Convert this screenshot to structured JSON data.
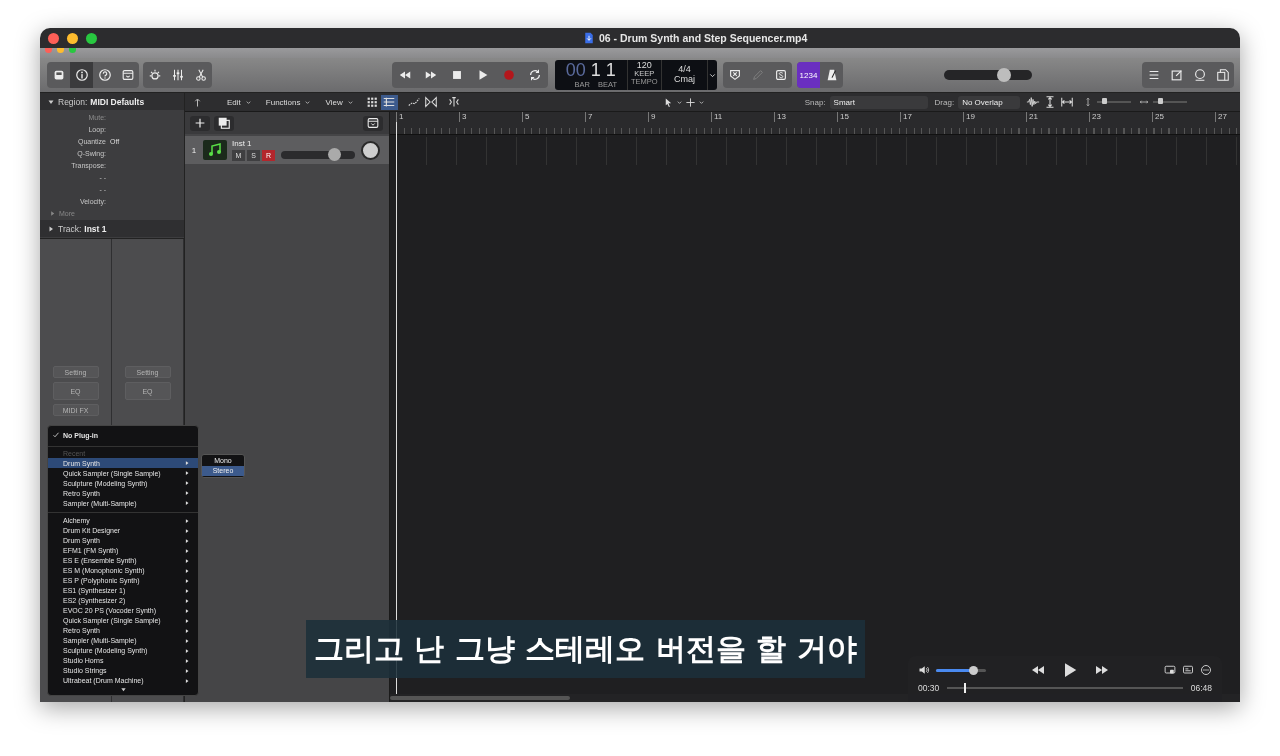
{
  "window": {
    "title": "06 - Drum Synth and Step Sequencer.mp4"
  },
  "control_bar": {
    "view_buttons": [
      {
        "kind": "library",
        "on": false
      },
      {
        "kind": "inspector",
        "on": true
      },
      {
        "kind": "help",
        "on": false
      },
      {
        "kind": "toolbar",
        "on": false
      }
    ],
    "cycle": {
      "on": false
    },
    "lcd": {
      "bar_dim": "00",
      "bar": "1",
      "beat": "1",
      "bar_label": "BAR",
      "beat_label": "BEAT",
      "tempo": "120",
      "tempo_mode": "KEEP",
      "tempo_label": "TEMPO",
      "signature": "4/4",
      "key": "Cmaj"
    },
    "count_in": {
      "label": "1234",
      "on": true
    },
    "master_volume": {
      "level": 0.68
    }
  },
  "inspector": {
    "region": {
      "prefix": "Region:",
      "name": "MIDI Defaults",
      "expanded": true
    },
    "parameters": [
      {
        "label": "Mute:",
        "disabled": true
      },
      {
        "label": "Loop:",
        "disabled": false
      },
      {
        "label": "Quantize",
        "value": "Off",
        "disabled": false
      },
      {
        "label": "Q-Swing:",
        "disabled": false
      },
      {
        "label": "Transpose:",
        "disabled": false
      },
      {
        "label": "- -",
        "disabled": false
      },
      {
        "label": "- -",
        "disabled": false
      },
      {
        "label": "Velocity:",
        "disabled": false
      }
    ],
    "more": "More",
    "track": {
      "prefix": "Track:",
      "name": "Inst 1",
      "expanded": false
    },
    "channel_strips": [
      {
        "buttons": [
          "Setting",
          "EQ",
          "MIDI FX"
        ]
      },
      {
        "buttons": [
          "Setting",
          "EQ"
        ]
      }
    ]
  },
  "tracks_toolbar": {
    "menus": [
      "Edit",
      "Functions",
      "View"
    ],
    "view_modes": [
      {
        "kind": "grid",
        "selected": false
      },
      {
        "kind": "list",
        "selected": true
      }
    ],
    "snap_label": "Snap:",
    "snap": "Smart",
    "drag_label": "Drag:",
    "drag": "No Overlap",
    "vertical_zoom": {
      "level": 0.2
    },
    "horizontal_zoom": {
      "level": 0.2
    }
  },
  "tracks": [
    {
      "number": "1",
      "name": "Inst 1",
      "buttons": [
        {
          "label": "M",
          "on": false
        },
        {
          "label": "S",
          "on": false
        },
        {
          "label": "R",
          "on": true
        }
      ],
      "volume": {
        "level": 0.72
      }
    }
  ],
  "ruler": [
    "1",
    "3",
    "5",
    "7",
    "9",
    "11",
    "13",
    "15",
    "17",
    "19",
    "21",
    "23",
    "25",
    "27"
  ],
  "plugin_menu": {
    "checked_item": {
      "label": "No Plug-in",
      "checked": true
    },
    "sections": [
      {
        "header": "Recent",
        "items": [
          {
            "label": "Drum Synth",
            "selected": true
          },
          {
            "label": "Quick Sampler (Single Sample)",
            "selected": false
          },
          {
            "label": "Sculpture  (Modeling Synth)",
            "selected": false
          },
          {
            "label": "Retro Synth",
            "selected": false
          },
          {
            "label": "Sampler (Multi-Sample)",
            "selected": false
          }
        ]
      },
      {
        "items": [
          {
            "label": "Alchemy",
            "selected": false
          },
          {
            "label": "Drum Kit Designer",
            "selected": false
          },
          {
            "label": "Drum Synth",
            "selected": false
          },
          {
            "label": "EFM1  (FM Synth)",
            "selected": false
          },
          {
            "label": "ES E  (Ensemble Synth)",
            "selected": false
          },
          {
            "label": "ES M  (Monophonic Synth)",
            "selected": false
          },
          {
            "label": "ES P  (Polyphonic Synth)",
            "selected": false
          },
          {
            "label": "ES1  (Synthesizer 1)",
            "selected": false
          },
          {
            "label": "ES2  (Synthesizer 2)",
            "selected": false
          },
          {
            "label": "EVOC 20 PS  (Vocoder Synth)",
            "selected": false
          },
          {
            "label": "Quick Sampler (Single Sample)",
            "selected": false
          },
          {
            "label": "Retro Synth",
            "selected": false
          },
          {
            "label": "Sampler (Multi-Sample)",
            "selected": false
          },
          {
            "label": "Sculpture  (Modeling Synth)",
            "selected": false
          },
          {
            "label": "Studio Horns",
            "selected": false
          },
          {
            "label": "Studio Strings",
            "selected": false
          },
          {
            "label": "Ultrabeat (Drum Machine)",
            "selected": false
          }
        ]
      }
    ]
  },
  "submenu": [
    {
      "label": "Mono",
      "selected": false
    },
    {
      "label": "Stereo",
      "selected": true
    }
  ],
  "subtitle": "그리고 난 그냥 스테레오 버전을 할 거야",
  "player": {
    "volume": {
      "level": 0.75
    },
    "elapsed": "00:30",
    "progress": {
      "level": 0.07
    },
    "duration": "06:48"
  }
}
